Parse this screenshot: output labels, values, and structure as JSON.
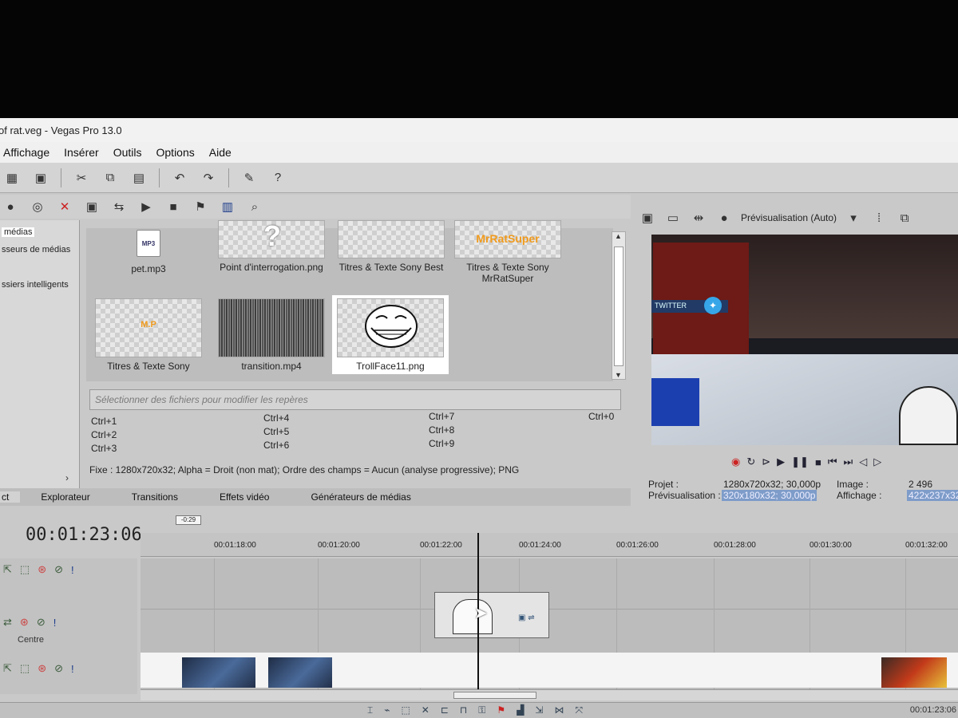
{
  "window": {
    "title": "of rat.veg - Vegas Pro 13.0"
  },
  "menu": [
    "Affichage",
    "Insérer",
    "Outils",
    "Options",
    "Aide"
  ],
  "media_sidebar": {
    "items": [
      "médias",
      "sseurs de médias",
      "ssiers intelligents"
    ]
  },
  "media_items": [
    {
      "label": "pet.mp3",
      "kind": "mp3",
      "icon_text": "MP3"
    },
    {
      "label": "Point d'interrogation.png",
      "kind": "question"
    },
    {
      "label": "Titres & Texte Sony Best",
      "kind": "checker"
    },
    {
      "label": "Titres & Texte Sony MrRatSuper",
      "kind": "logo",
      "logo_text": "MrRatSuper"
    },
    {
      "label": "Titres & Texte Sony",
      "kind": "logo-small",
      "logo_text": "M.P"
    },
    {
      "label": "transition.mp4",
      "kind": "noise"
    },
    {
      "label": "TrollFace11.png",
      "kind": "troll",
      "selected": true
    }
  ],
  "markers_placeholder": "Sélectionner des fichiers pour modifier les repères",
  "shortcuts": {
    "col1": [
      "Ctrl+1",
      "Ctrl+2",
      "Ctrl+3"
    ],
    "col2": [
      "Ctrl+4",
      "Ctrl+5",
      "Ctrl+6"
    ],
    "col3": [
      "Ctrl+7",
      "Ctrl+8",
      "Ctrl+9"
    ],
    "col4": [
      "Ctrl+0"
    ]
  },
  "media_info": "Fixe : 1280x720x32; Alpha = Droit (non mat); Ordre des champs = Aucun (analyse progressive); PNG",
  "tabs": [
    "ct",
    "Explorateur",
    "Transitions",
    "Effets vidéo",
    "Générateurs de médias"
  ],
  "preview": {
    "mode": "Prévisualisation (Auto)",
    "overlay_tag": "TWITTER",
    "projet_label": "Projet :",
    "projet_value": "1280x720x32; 30,000p",
    "previsualisation_label": "Prévisualisation :",
    "previsualisation_value": "320x180x32; 30,000p",
    "image_label": "Image :",
    "image_value": "2 496",
    "affichage_label": "Affichage :",
    "affichage_value": "422x237x32"
  },
  "timeline": {
    "timecode": "00:01:23:06",
    "flag": "-0:29",
    "ruler": [
      "00:01:18:00",
      "00:01:20:00",
      "00:01:22:00",
      "00:01:24:00",
      "00:01:26:00",
      "00:01:28:00",
      "00:01:30:00",
      "00:01:32:00"
    ],
    "track_label": "Centre",
    "bottom_time": "00:01:23:06"
  }
}
